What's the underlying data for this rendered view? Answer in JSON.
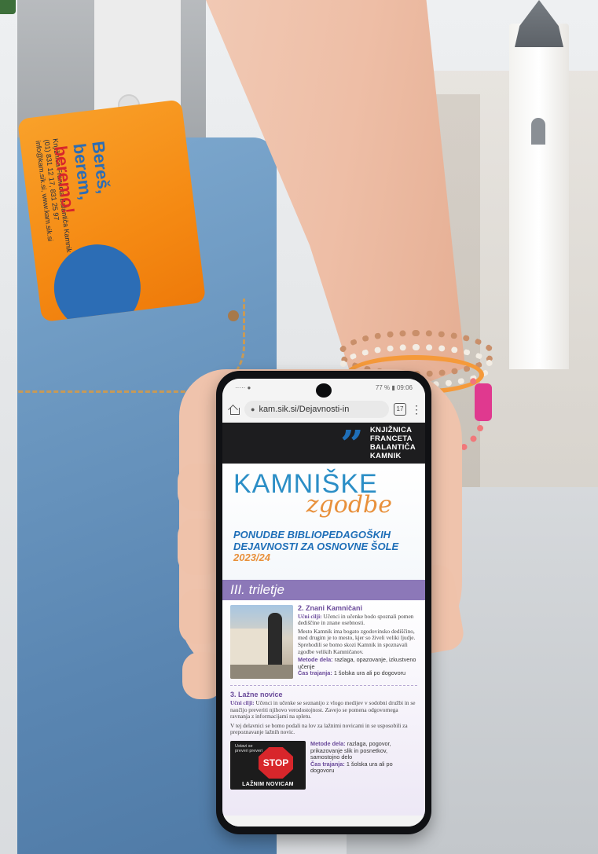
{
  "card": {
    "slogan_line1": "Bereš,",
    "slogan_line2": "berem,",
    "slogan_line3": "beremo!",
    "library": "Knjižnica Franceta Balantiča Kamnik",
    "phone": "(01) 831 12 17, 831 25 97",
    "web": "info@kam.sik.si, www.kam.sik.si"
  },
  "phone": {
    "status": {
      "signal": "····· ●",
      "battery": "77 % ▮ 09:06"
    },
    "browser": {
      "url": "kam.sik.si/Dejavnosti-in",
      "tabs_count": "17",
      "menu": "⋮"
    },
    "header": {
      "logo_mark": "”",
      "library_lines": [
        "KNJIŽNICA",
        "FRANCETA",
        "BALANTIČA",
        "KAMNIK"
      ]
    },
    "hero": {
      "title": "KAMNIŠKE",
      "script": "zgodbe",
      "subtitle": "PONUDBE BIBLIOPEDAGOŠKIH DEJAVNOSTI ZA OSNOVNE ŠOLE",
      "year": "2023/24"
    },
    "section": "III. triletje",
    "item1": {
      "title": "2. Znani Kamničani",
      "goal_label": "Učni cilji:",
      "goal_text": "Učenci in učenke bodo spoznali pomen dediščine in znane osebnosti.",
      "description": "Mesto Kamnik ima bogato zgodovinsko dediščino, med drugim je to mesto, kjer so živeli veliki ljudje. Sprehodili se bomo skozi Kamnik in spoznavali zgodbe velikih Kamničanov.",
      "methods_label": "Metode dela:",
      "methods_text": "razlaga, opazovanje, izkustveno učenje",
      "duration_label": "Čas trajanja:",
      "duration_text": "1 šolska ura ali po dogovoru"
    },
    "item3": {
      "title": "3. Lažne novice",
      "goal_label": "Učni cilji:",
      "goal_text": "Učenci in učenke se seznanijo z vlogo medijev v sodobni družbi in se naučijo preveriti njihovo verodostojnost. Zavejo se pomena odgovornega ravnanja z informacijami na spletu.",
      "description": "V tej delavnici se bomo podali na lov za lažnimi novicami in se usposobili za prepoznavanje lažnih novic.",
      "photo_top": "Ustavi se preveri preveri",
      "stop_text": "STOP",
      "photo_caption": "LAŽNIM NOVICAM",
      "methods_label": "Metode dela:",
      "methods_text": "razlaga, pogovor, prikazovanje slik in posnetkov, samostojno delo",
      "duration_label": "Čas trajanja:",
      "duration_text": "1 šolska ura ali po dogovoru"
    }
  }
}
